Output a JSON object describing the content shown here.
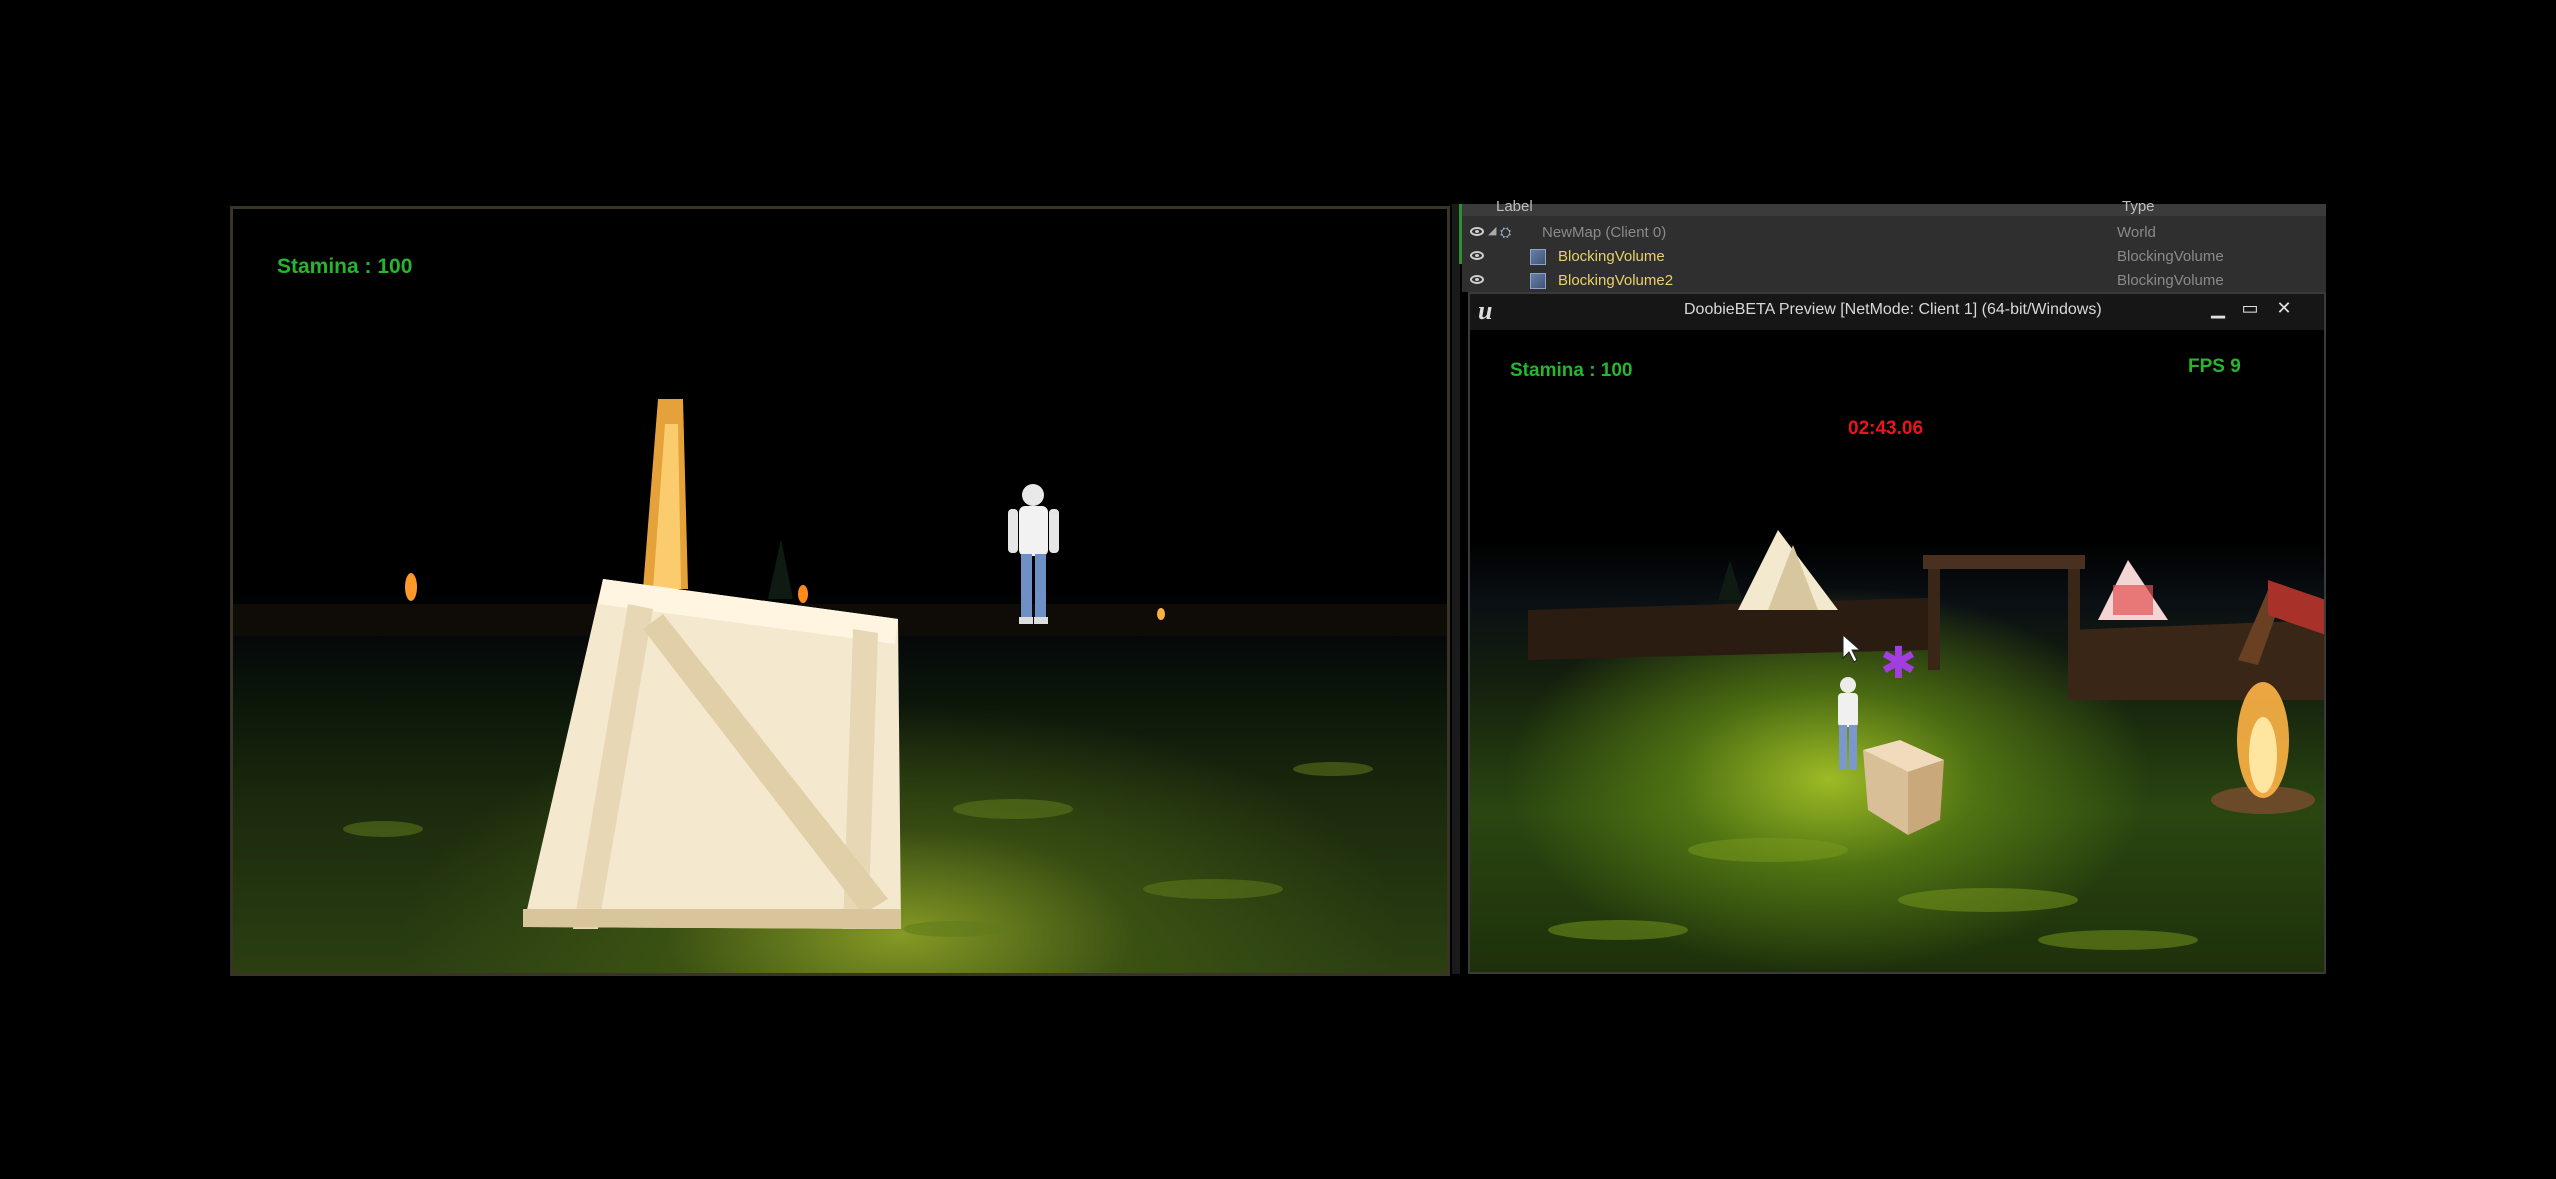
{
  "left_view": {
    "stamina_text": "Stamina : 100"
  },
  "outliner": {
    "columns": {
      "label": "Label",
      "type": "Type"
    },
    "rows": [
      {
        "label": "NewMap (Client 0)",
        "type": "World"
      },
      {
        "label": "BlockingVolume",
        "type": "BlockingVolume"
      },
      {
        "label": "BlockingVolume2",
        "type": "BlockingVolume"
      }
    ]
  },
  "preview_window": {
    "title": "DoobieBETA Preview [NetMode: Client 1]  (64-bit/Windows)",
    "stamina_text": "Stamina : 100",
    "fps_text": "FPS 9",
    "timer_text": "02:43.06"
  },
  "colors": {
    "hud_green": "#27b52d",
    "timer_red": "#e8161c",
    "selected_label": "#e8d06a"
  }
}
